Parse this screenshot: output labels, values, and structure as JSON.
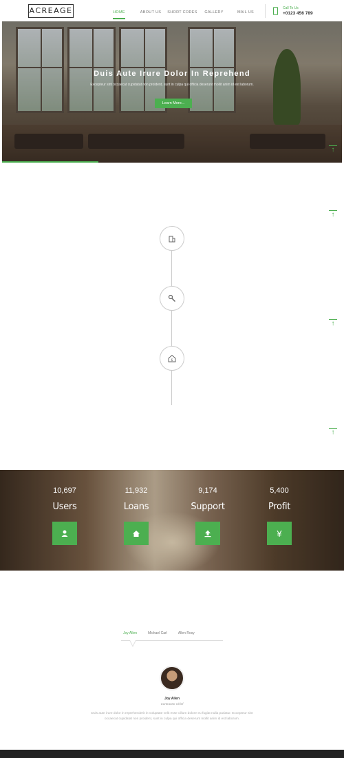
{
  "header": {
    "logo": "ACREAGE",
    "nav": [
      "HOME",
      "ABOUT US",
      "SHORT CODES",
      "GALLERY",
      "MAIL US"
    ],
    "contact_label": "Call To Us",
    "contact_phone": "+0123 456 789"
  },
  "hero": {
    "title": "Duis Aute Irure Dolor In Reprehend",
    "text": "Excepteur sint occaecat cupidatat non proident, sunt in culpa qui officia deserunt mollit anim id est laborum.",
    "button": "Learn More..."
  },
  "timeline": {
    "icons": [
      "building-icon",
      "wrench-icon",
      "house-money-icon"
    ]
  },
  "stats": [
    {
      "value": "10,697",
      "label": "Users",
      "icon": "user-icon"
    },
    {
      "value": "11,932",
      "label": "Loans",
      "icon": "home-icon"
    },
    {
      "value": "9,174",
      "label": "Support",
      "icon": "upload-icon"
    },
    {
      "value": "5,400",
      "label": "Profit",
      "icon": "yen-icon"
    }
  ],
  "testimonials": {
    "tabs": [
      "Joy Allen",
      "Michael Carl",
      "Allen Rosy"
    ],
    "name": "Joy Allen",
    "role": "Contractor Chief",
    "text": "Duis aute irure dolor in reprehenderit in voluptate velit esse cillum dolore eu fugiat nulla pariatur. Excepteur sint occaecat cupidatat non proident, sunt in culpa qui officia deserunt mollit anim id est laborum."
  },
  "colors": {
    "accent": "#4caf50"
  }
}
